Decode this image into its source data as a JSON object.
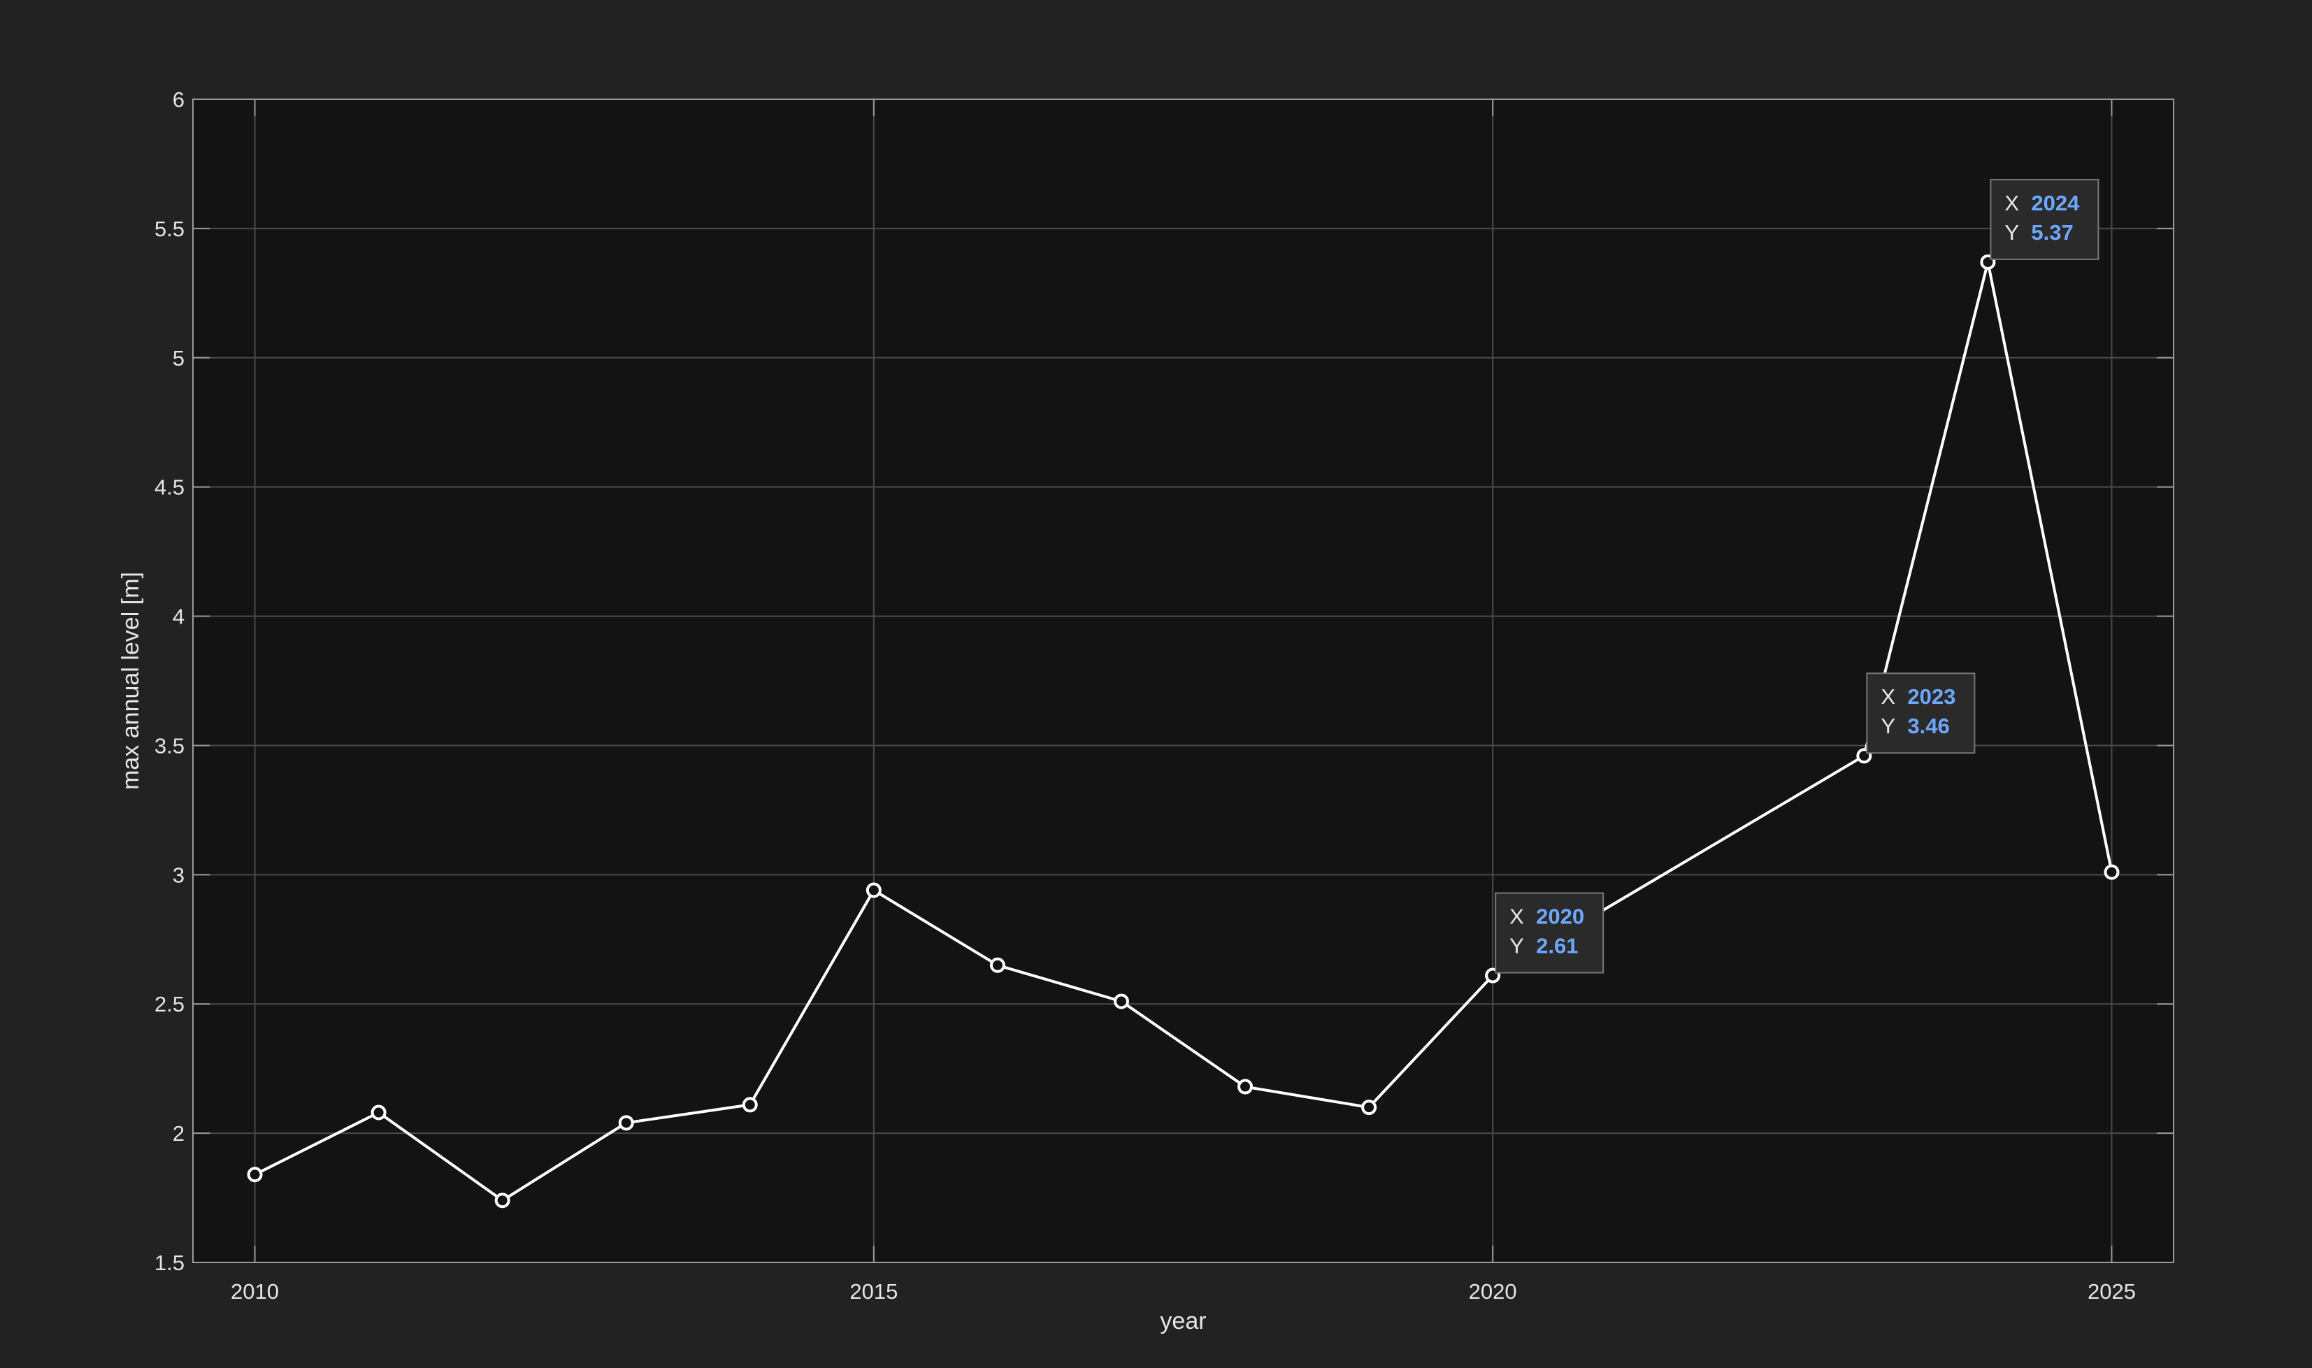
{
  "chart_data": {
    "type": "line",
    "title": "",
    "xlabel": "year",
    "ylabel": "max annual level [m]",
    "xlim": [
      2009.5,
      2025.5
    ],
    "ylim": [
      1.5,
      6
    ],
    "xticks": [
      2010,
      2015,
      2020,
      2025
    ],
    "yticks": [
      1.5,
      2,
      2.5,
      3,
      3.5,
      4,
      4.5,
      5,
      5.5,
      6
    ],
    "xtick_labels": [
      "2010",
      "2015",
      "2020",
      "2025"
    ],
    "ytick_labels": [
      "1.5",
      "2",
      "2.5",
      "3",
      "3.5",
      "4",
      "4.5",
      "5",
      "5.5",
      "6"
    ],
    "grid": true,
    "series": [
      {
        "x": [
          2010,
          2011,
          2012,
          2013,
          2014,
          2015,
          2016,
          2017,
          2018,
          2019,
          2020,
          2023,
          2024,
          2025
        ],
        "values": [
          1.84,
          2.08,
          1.74,
          2.04,
          2.11,
          2.94,
          2.65,
          2.51,
          2.18,
          2.1,
          2.61,
          3.46,
          5.37,
          3.01
        ],
        "marker": "circle",
        "color": "#ffffff"
      }
    ],
    "datatips": [
      {
        "x": 2020,
        "y": 2.61,
        "x_label": "X",
        "y_label": "Y",
        "x_text": "2020",
        "y_text": "2.61"
      },
      {
        "x": 2023,
        "y": 3.46,
        "x_label": "X",
        "y_label": "Y",
        "x_text": "2023",
        "y_text": "3.46"
      },
      {
        "x": 2024,
        "y": 5.37,
        "x_label": "X",
        "y_label": "Y",
        "x_text": "2024",
        "y_text": "5.37"
      }
    ]
  },
  "colors": {
    "figure_background": "#222222",
    "axes_background": "#131313",
    "axes_border": "#9a9a9a",
    "grid": "#4a4a4a",
    "tick_text": "#e6e6e6",
    "line": "#ffffff",
    "datatip_background": "#2a2a2a",
    "datatip_border": "#777777",
    "datatip_label": "#e8e8e8",
    "datatip_value": "#6fa8ff"
  }
}
